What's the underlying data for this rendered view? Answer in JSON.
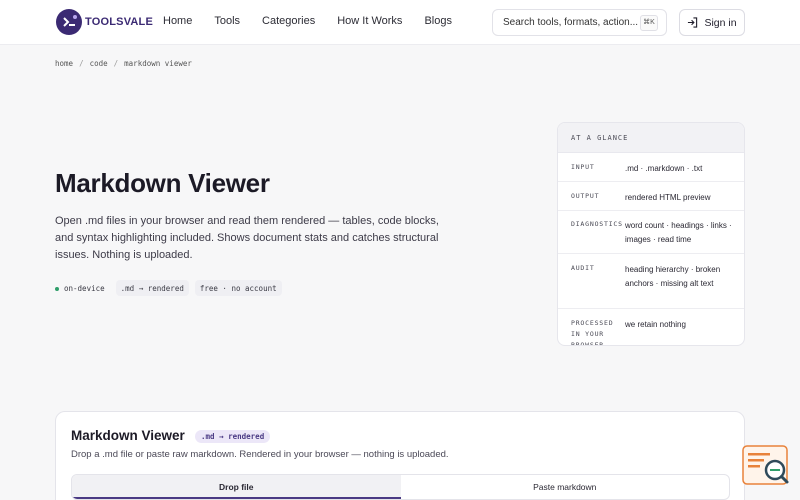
{
  "header": {
    "logo_text": "TOOLSVALE",
    "nav": [
      "Home",
      "Tools",
      "Categories",
      "How It Works",
      "Blogs"
    ],
    "search_placeholder": "Search tools, formats, action...",
    "search_shortcut": "⌘K",
    "signin_label": "Sign in"
  },
  "breadcrumb": [
    "home",
    "code",
    "markdown viewer"
  ],
  "hero": {
    "title": "Markdown Viewer",
    "description": "Open .md files in your browser and read them rendered — tables, code blocks, and syntax highlighting included. Shows document stats and catches structural issues. Nothing is uploaded.",
    "pills": [
      "on-device",
      ".md → rendered",
      "free · no account"
    ]
  },
  "glance": {
    "heading": "AT A GLANCE",
    "rows": [
      {
        "key": "INPUT",
        "value": ".md · .markdown · .txt"
      },
      {
        "key": "OUTPUT",
        "value": "rendered HTML preview"
      },
      {
        "key": "DIAGNOSTICS",
        "value": "word count · headings · links · images · read time"
      },
      {
        "key": "AUDIT",
        "value": "heading hierarchy · broken anchors · missing alt text"
      },
      {
        "key": "PROCESSED IN YOUR BROWSER",
        "value": "we retain nothing"
      }
    ]
  },
  "tool": {
    "title": "Markdown Viewer",
    "badge": ".md → rendered",
    "description": "Drop a .md file or paste raw markdown. Rendered in your browser — nothing is uploaded.",
    "tabs": [
      "Drop file",
      "Paste markdown"
    ],
    "active_tab": "Drop file"
  },
  "colors": {
    "brand": "#3b2a73",
    "accent": "#4a3a84",
    "status_dot": "#2f9e6a",
    "helper_orange": "#e8823a"
  }
}
